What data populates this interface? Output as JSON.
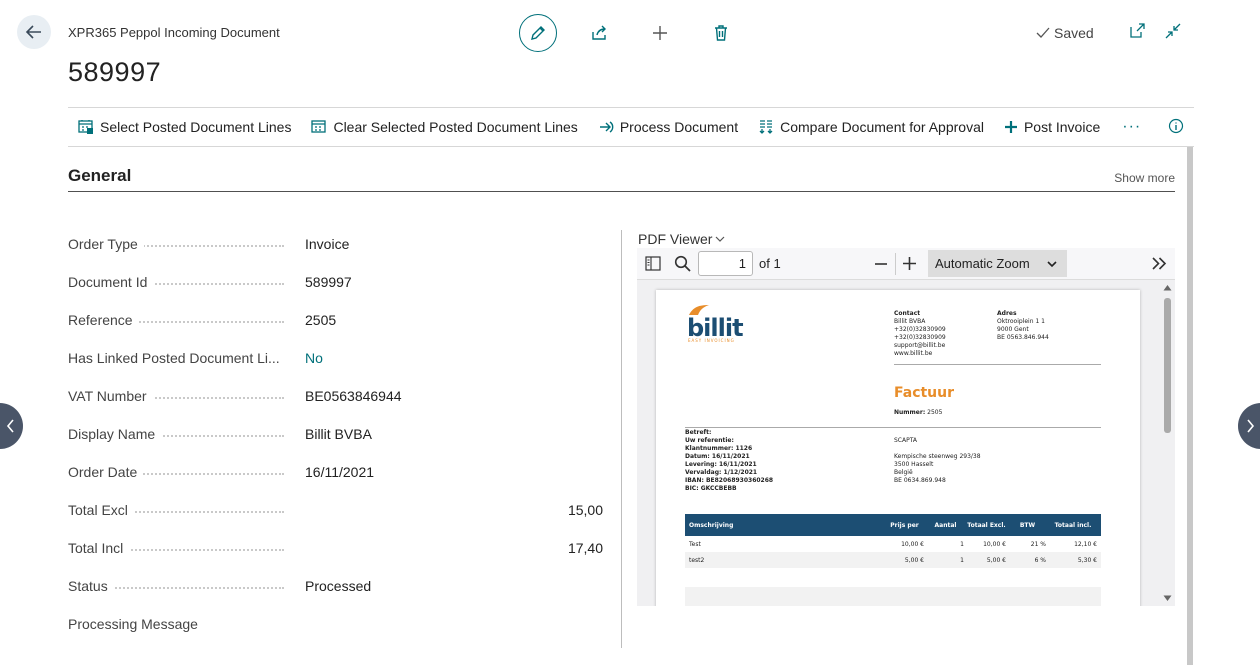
{
  "header": {
    "caption": "XPR365 Peppol Incoming Document",
    "title": "589997",
    "saved_label": "Saved"
  },
  "actions": [
    {
      "label": "Select Posted Document Lines",
      "icon": "select-lines-icon"
    },
    {
      "label": "Clear Selected Posted Document Lines",
      "icon": "clear-lines-icon"
    },
    {
      "label": "Process Document",
      "icon": "process-icon"
    },
    {
      "label": "Compare Document for Approval",
      "icon": "compare-icon"
    },
    {
      "label": "Post Invoice",
      "icon": "post-icon"
    }
  ],
  "more_label": "···",
  "section": {
    "title": "General",
    "show_more": "Show more"
  },
  "fields": [
    {
      "label": "Order Type",
      "value": "Invoice"
    },
    {
      "label": "Document Id",
      "value": "589997"
    },
    {
      "label": "Reference",
      "value": "2505"
    },
    {
      "label": "Has Linked Posted Document Li...",
      "value": "No"
    },
    {
      "label": "VAT Number",
      "value": "BE0563846944"
    },
    {
      "label": "Display Name",
      "value": "Billit BVBA"
    },
    {
      "label": "Order Date",
      "value": "16/11/2021"
    },
    {
      "label": "Total Excl",
      "value": "15,00"
    },
    {
      "label": "Total Incl",
      "value": "17,40"
    },
    {
      "label": "Status",
      "value": "Processed"
    },
    {
      "label": "Processing Message",
      "value": ""
    }
  ],
  "pdf": {
    "label": "PDF Viewer",
    "page_number": "1",
    "page_of": "of 1",
    "zoom": "Automatic Zoom",
    "document": {
      "logo": "billit",
      "logo_tagline": "EASY INVOICING",
      "contact_title": "Contact",
      "contact_lines": [
        "Billit BVBA",
        "+32(0)32830909",
        "+32(0)32830909",
        "support@billit.be",
        "www.billit.be"
      ],
      "address_title": "Adres",
      "address_lines": [
        "Oktrooiplein 1 1",
        "9000 Gent",
        "BE 0563.846.944"
      ],
      "doc_type": "Factuur",
      "number_label": "Nummer:",
      "number": "2505",
      "meta_lines": [
        "Betreft:",
        "Uw referentie:",
        "Klantnummer: 1126",
        "Datum: 16/11/2021",
        "Levering: 16/11/2021",
        "Vervaldag: 1/12/2021",
        "IBAN: BE82068930360268",
        "BIC: GKCCBEBB"
      ],
      "customer_lines": [
        "SCAPTA",
        "",
        "Kempische steenweg 293/38",
        "3500 Hasselt",
        "België",
        "BE 0634.869.948"
      ],
      "table_headers": [
        "Omschrijving",
        "Prijs per",
        "Aantal",
        "Totaal Excl.",
        "BTW",
        "Totaal incl."
      ],
      "rows": [
        [
          "Test",
          "10,00 €",
          "1",
          "10,00 €",
          "21 %",
          "12,10 €"
        ],
        [
          "test2",
          "5,00 €",
          "1",
          "5,00 €",
          "6 %",
          "5,30 €"
        ]
      ]
    }
  }
}
